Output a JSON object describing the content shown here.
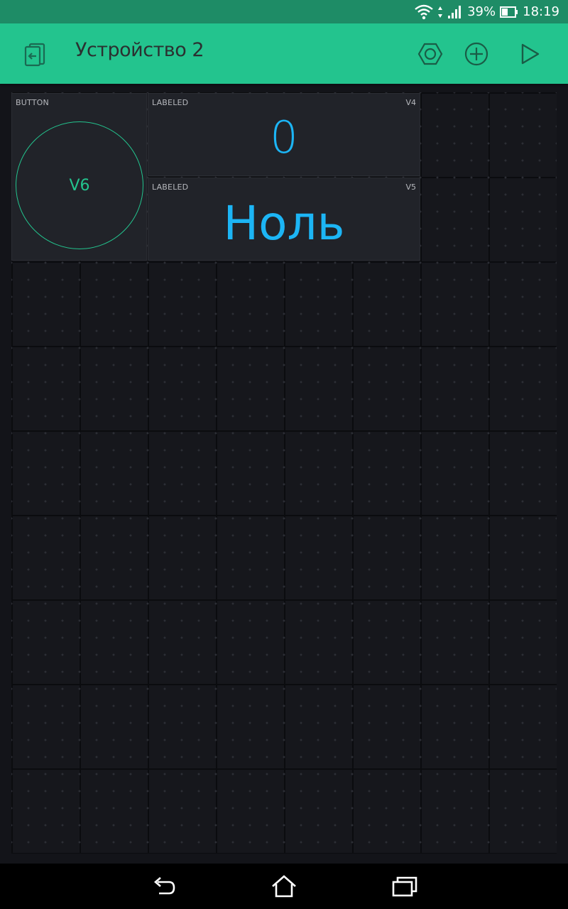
{
  "status_bar": {
    "battery_percent": "39%",
    "time": "18:19",
    "icons": [
      "wifi-icon",
      "signal-icon",
      "battery-icon"
    ]
  },
  "app_bar": {
    "title": "Устройство 2",
    "actions": [
      "project-settings-icon",
      "add-widget-icon",
      "play-icon"
    ],
    "background_color": "#23c48e"
  },
  "widgets": {
    "button": {
      "label": "BUTTON",
      "pin": "V6"
    },
    "labeled_v4": {
      "label": "LABELED",
      "pin": "V4",
      "value": "0"
    },
    "labeled_v5": {
      "label": "LABELED",
      "pin": "V5",
      "value": "Ноль"
    }
  },
  "colors": {
    "accent_green": "#23c48e",
    "value_blue": "#1cb5f5",
    "canvas_background": "#16171c"
  },
  "nav_bar": {
    "buttons": [
      "back-icon",
      "home-icon",
      "recent-apps-icon"
    ]
  }
}
